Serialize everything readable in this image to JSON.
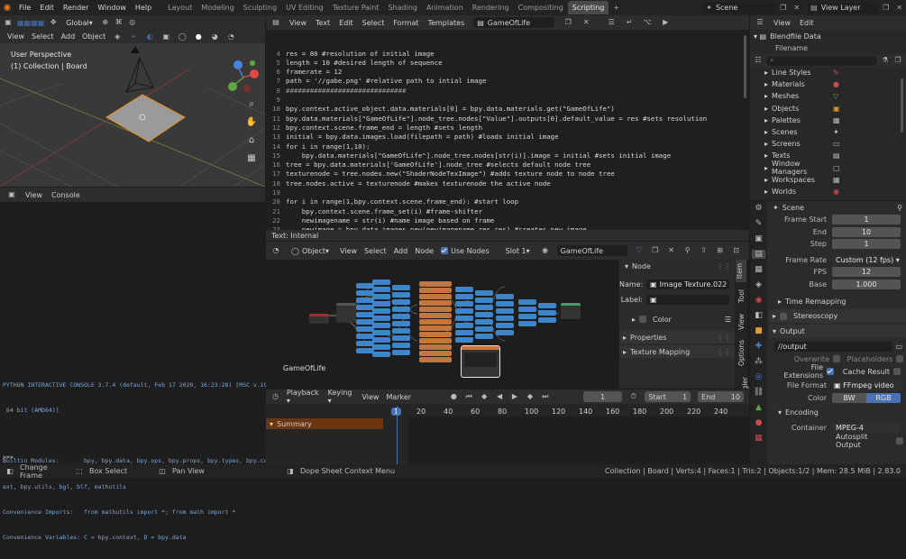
{
  "topbar": {
    "menus": [
      "File",
      "Edit",
      "Render",
      "Window",
      "Help"
    ],
    "workspaces": [
      "Layout",
      "Modeling",
      "Sculpting",
      "UV Editing",
      "Texture Paint",
      "Shading",
      "Animation",
      "Rendering",
      "Compositing",
      "Scripting"
    ],
    "active_workspace": "Scripting",
    "scene": "Scene",
    "view_layer": "View Layer"
  },
  "viewport": {
    "orientation": "Global",
    "menus": [
      "View",
      "Select",
      "Add",
      "Object"
    ],
    "overlay_title": "User Perspective",
    "overlay_collection": "(1) Collection | Board"
  },
  "console": {
    "menus": [
      "View",
      "Console"
    ],
    "lines": [
      "PYTHON INTERACTIVE CONSOLE 3.7.4 (default, Feb 17 2020, 16:23:28) [MSC v.1916",
      " 64 bit (AMD64)]",
      "",
      "Builtin Modules:       bpy, bpy.data, bpy.ops, bpy.props, bpy.types, bpy.cont",
      "ext, bpy.utils, bgl, blf, mathutils",
      "Convenience Imports:   from mathutils import *; from math import *",
      "Convenience Variables: C = bpy.context, D = bpy.data"
    ],
    "prompt": ">>>"
  },
  "text_editor": {
    "menus": [
      "View",
      "Text",
      "Edit",
      "Select",
      "Format",
      "Templates"
    ],
    "filename": "GameOfLife",
    "footer": "Text: Internal",
    "lines": [
      {
        "n": "4",
        "t": "res = 80 #resolution of initial image"
      },
      {
        "n": "5",
        "t": "length = 10 #desired length of sequence"
      },
      {
        "n": "6",
        "t": "framerate = 12"
      },
      {
        "n": "7",
        "t": "path = '//gabe.png' #relative path to intial image"
      },
      {
        "n": "8",
        "t": "##############################"
      },
      {
        "n": "9",
        "t": ""
      },
      {
        "n": "10",
        "t": "bpy.context.active_object.data.materials[0] = bpy.data.materials.get(\"GameOfLife\")"
      },
      {
        "n": "11",
        "t": "bpy.data.materials[\"GameOfLife\"].node_tree.nodes[\"Value\"].outputs[0].default_value = res #sets resolution"
      },
      {
        "n": "12",
        "t": "bpy.context.scene.frame_end = length #sets length"
      },
      {
        "n": "13",
        "t": "initial = bpy.data.images.load(filepath = path) #loads initial image"
      },
      {
        "n": "14",
        "t": "for i in range(1,10):"
      },
      {
        "n": "15",
        "t": "    bpy.data.materials[\"GameOfLife\"].node_tree.nodes[str(i)].image = initial #sets initial image"
      },
      {
        "n": "16",
        "t": "tree = bpy.data.materials['GameOfLife'].node_tree #selects default node tree"
      },
      {
        "n": "17",
        "t": "texturenode = tree.nodes.new(\"ShaderNodeTexImage\") #adds texture node to node tree"
      },
      {
        "n": "18",
        "t": "tree.nodes.active = texturenode #makes texturenode the active node"
      },
      {
        "n": "19",
        "t": ""
      },
      {
        "n": "20",
        "t": "for i in range(1,bpy.context.scene.frame_end): #start loop"
      },
      {
        "n": "21",
        "t": "    bpy.context.scene.frame_set(i) #frame-shifter"
      },
      {
        "n": "22",
        "t": "    newimagename = str(i) #name image based on frame"
      },
      {
        "n": "23",
        "t": "    newimage = bpy.data.images.new(newimagename,res,res) #creates new image"
      },
      {
        "n": "24",
        "t": "    texturenode.image = newimage #assigns image to node"
      }
    ]
  },
  "node_editor": {
    "mode": "Object",
    "menus": [
      "View",
      "Select",
      "Add",
      "Node"
    ],
    "use_nodes_label": "Use Nodes",
    "slot": "Slot 1",
    "material": "GameOfLife",
    "canvas_label": "GameOfLife",
    "sidebar": {
      "section": "Node",
      "name_label": "Name:",
      "name_value": "Image Texture.022",
      "label_label": "Label:",
      "color_label": "Color",
      "properties": "Properties",
      "texture_mapping": "Texture Mapping",
      "tabs": [
        "Item",
        "Tool",
        "View",
        "Options",
        "Node Wrangler"
      ]
    }
  },
  "timeline": {
    "menus": [
      "Playback",
      "Keying",
      "View",
      "Marker"
    ],
    "current_frame": "1",
    "start_label": "Start",
    "start": "1",
    "end_label": "End",
    "end": "10",
    "summary": "Summary",
    "ruler": [
      "1",
      "20",
      "40",
      "60",
      "80",
      "100",
      "120",
      "140",
      "160",
      "180",
      "200",
      "220",
      "240"
    ]
  },
  "outliner": {
    "menus": [
      "View",
      "Edit"
    ],
    "mode": "Blendfile Data",
    "filename": "Filename",
    "items": [
      "Line Styles",
      "Materials",
      "Meshes",
      "Objects",
      "Palettes",
      "Scenes",
      "Screens",
      "Texts",
      "Window Managers",
      "Workspaces",
      "Worlds"
    ]
  },
  "properties": {
    "scene": "Scene",
    "frame_start_label": "Frame Start",
    "frame_start": "1",
    "end_label": "End",
    "end": "10",
    "step_label": "Step",
    "step": "1",
    "frame_rate_label": "Frame Rate",
    "frame_rate": "Custom (12 fps)",
    "fps_label": "FPS",
    "fps": "12",
    "base_label": "Base",
    "base": "1.000",
    "time_remapping": "Time Remapping",
    "stereoscopy": "Stereoscopy",
    "output": "Output",
    "output_path": "//output",
    "overwrite": "Overwrite",
    "placeholders": "Placeholders",
    "file_extensions": "File Extensions",
    "cache_result": "Cache Result",
    "file_format_label": "File Format",
    "file_format": "FFmpeg video",
    "color_label": "Color",
    "color_bw": "BW",
    "color_rgb": "RGB",
    "encoding": "Encoding",
    "container_label": "Container",
    "container": "MPEG-4",
    "autosplit": "Autosplit Output"
  },
  "statusbar": {
    "change_frame": "Change Frame",
    "box_select": "Box Select",
    "pan_view": "Pan View",
    "context_menu": "Dope Sheet Context Menu",
    "stats": "Collection | Board | Verts:4 | Faces:1 | Tris:2 | Objects:1/2 | Mem: 28.5 MiB | 2.83.0"
  }
}
